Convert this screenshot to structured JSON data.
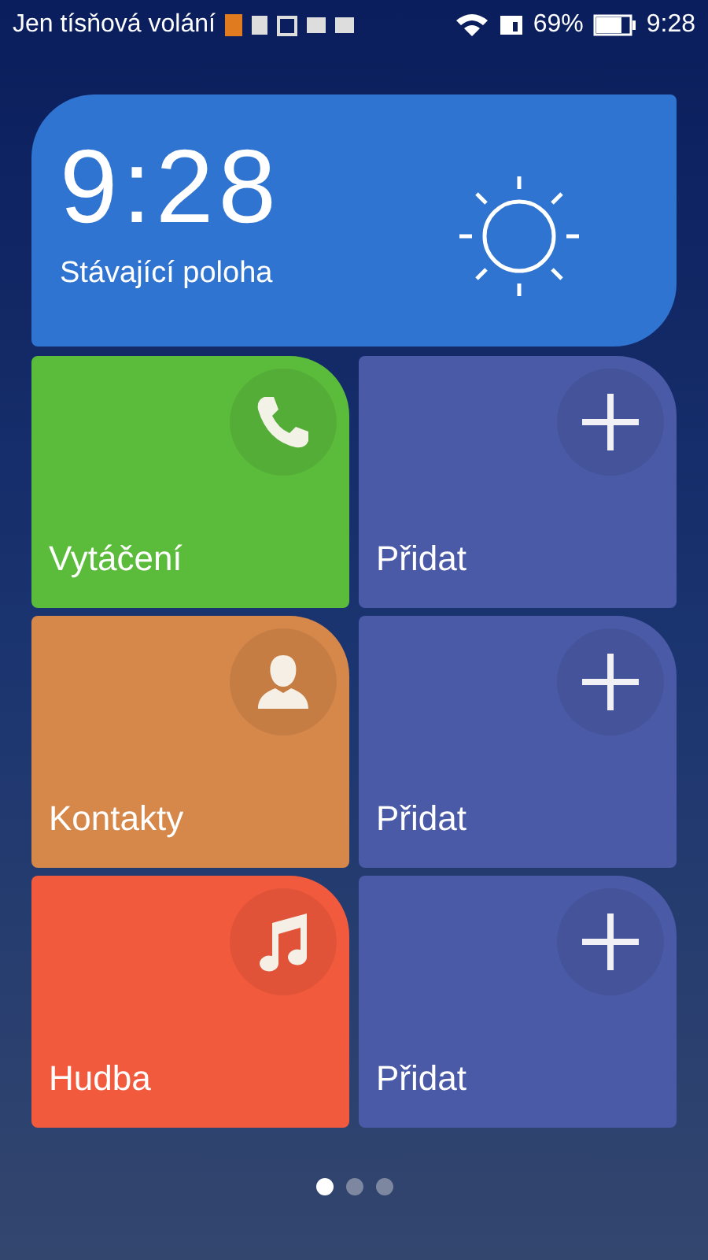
{
  "status_bar": {
    "carrier": "Jen tísňová volání",
    "battery": "69%",
    "time": "9:28"
  },
  "clock_widget": {
    "time": "9:28",
    "location": "Stávající poloha"
  },
  "tiles": [
    {
      "kind": "phone",
      "label": "Vytáčení",
      "color": "#5bbb3b"
    },
    {
      "kind": "add",
      "label": "Přidat",
      "color": "#4a5aa6"
    },
    {
      "kind": "contact",
      "label": "Kontakty",
      "color": "#d6874a"
    },
    {
      "kind": "add",
      "label": "Přidat",
      "color": "#4a5aa6"
    },
    {
      "kind": "music",
      "label": "Hudba",
      "color": "#f25a3d"
    },
    {
      "kind": "add",
      "label": "Přidat",
      "color": "#4a5aa6"
    }
  ],
  "pages": [
    {
      "selected": true
    },
    {
      "selected": false
    },
    {
      "selected": false
    }
  ]
}
